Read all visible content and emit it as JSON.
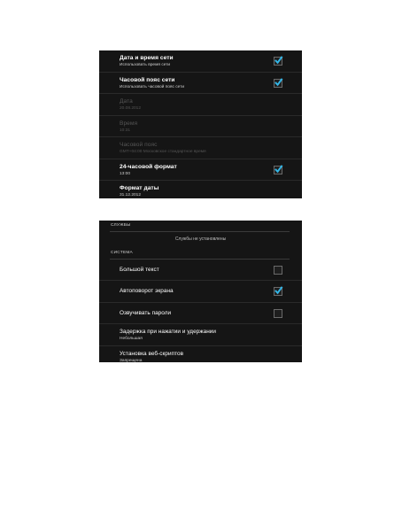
{
  "datetime_settings": {
    "items": [
      {
        "title": "Дата и время сети",
        "subtitle": "Использовать время сети",
        "checked": true,
        "disabled": false
      },
      {
        "title": "Часовой пояс сети",
        "subtitle": "Использовать часовой пояс сети",
        "checked": true,
        "disabled": false
      },
      {
        "title": "Дата",
        "subtitle": "20.08.2012",
        "disabled": true
      },
      {
        "title": "Время",
        "subtitle": "10:31",
        "disabled": true
      },
      {
        "title": "Часовой пояс",
        "subtitle": "GMT+04:00 Московское стандартное время",
        "disabled": true
      },
      {
        "title": "24-часовой формат",
        "subtitle": "13:00",
        "checked": true,
        "disabled": false
      },
      {
        "title": "Формат даты",
        "subtitle": "31.12.2012",
        "disabled": false
      }
    ]
  },
  "accessibility_settings": {
    "services_header": "СЛУЖБЫ",
    "services_empty": "Службы не установлены",
    "system_header": "СИСТЕМА",
    "items": [
      {
        "title": "Большой текст",
        "checked": false
      },
      {
        "title": "Автоповорот экрана",
        "checked": true
      },
      {
        "title": "Озвучивать пароли",
        "checked": false
      },
      {
        "title": "Задержка при нажатии и удержании",
        "subtitle": "Небольшая"
      },
      {
        "title": "Установка веб-скриптов",
        "subtitle": "Запрещена"
      }
    ]
  },
  "colors": {
    "panel_bg": "#151515",
    "checkmark": "#33b5e5",
    "divider": "#2a2a2a"
  }
}
